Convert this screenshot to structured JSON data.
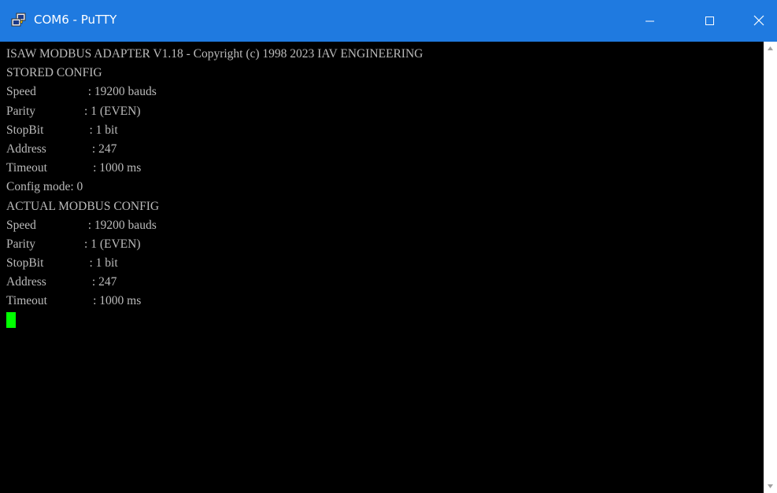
{
  "window": {
    "title": "COM6 - PuTTY",
    "icons": {
      "app": "putty-icon",
      "minimize": "minimize-icon",
      "maximize": "maximize-icon",
      "close": "close-icon",
      "scroll_up": "scroll-up-arrow-icon",
      "scroll_down": "scroll-down-arrow-icon"
    },
    "colors": {
      "titlebar": "#1f7ae0",
      "terminal_bg": "#000000",
      "terminal_text": "#bbbbbb",
      "cursor": "#00ff00"
    }
  },
  "terminal": {
    "lines": [
      "ISAW MODBUS ADAPTER V1.18 - Copyright (c) 1998 2023 IAV ENGINEERING",
      "STORED CONFIG",
      "Speed                 : 19200 bauds",
      "Parity                : 1 (EVEN)",
      "StopBit               : 1 bit",
      "Address               : 247",
      "Timeout               : 1000 ms",
      "Config mode: 0",
      "ACTUAL MODBUS CONFIG",
      "Speed                 : 19200 bauds",
      "Parity                : 1 (EVEN)",
      "StopBit               : 1 bit",
      "Address               : 247",
      "Timeout               : 1000 ms"
    ]
  }
}
